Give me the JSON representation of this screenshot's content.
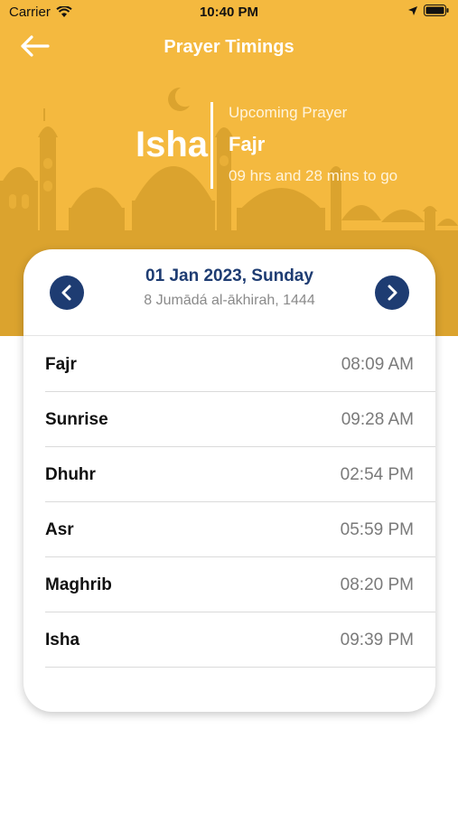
{
  "status_bar": {
    "carrier": "Carrier",
    "time": "10:40 PM"
  },
  "nav": {
    "title": "Prayer Timings"
  },
  "current_prayer": "Isha",
  "upcoming": {
    "label": "Upcoming Prayer",
    "name": "Fajr",
    "countdown": "09 hrs and 28 mins to go"
  },
  "date": {
    "gregorian": "01 Jan 2023, Sunday",
    "hijri": "8 Jumādá al-ākhirah, 1444"
  },
  "prayers": [
    {
      "name": "Fajr",
      "time": "08:09 AM"
    },
    {
      "name": "Sunrise",
      "time": "09:28 AM"
    },
    {
      "name": "Dhuhr",
      "time": "02:54 PM"
    },
    {
      "name": "Asr",
      "time": "05:59 PM"
    },
    {
      "name": "Maghrib",
      "time": "08:20 PM"
    },
    {
      "name": "Isha",
      "time": "09:39 PM"
    }
  ],
  "colors": {
    "header": "#F4B93F",
    "mosque_silhouette": "#DBA32E",
    "accent": "#1E3C72"
  },
  "icons": [
    "wifi-icon",
    "location-arrow-icon",
    "battery-icon",
    "back-arrow-icon",
    "crescent-moon-icon",
    "chevron-left-icon",
    "chevron-right-icon"
  ]
}
